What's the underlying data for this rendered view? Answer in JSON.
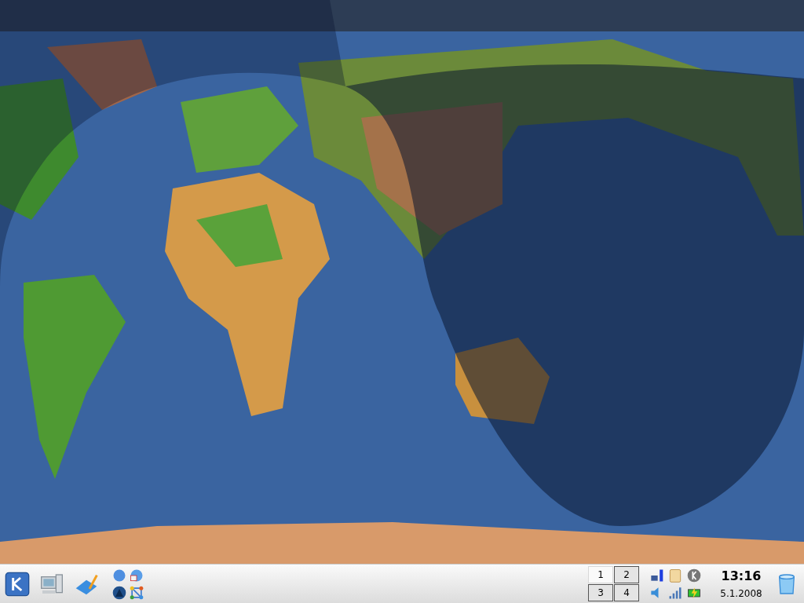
{
  "pager": {
    "desktops": [
      {
        "label": "1",
        "selected": true
      },
      {
        "label": "2",
        "selected": false
      },
      {
        "label": "3",
        "selected": false
      },
      {
        "label": "4",
        "selected": false
      }
    ]
  },
  "clock": {
    "time": "13:16",
    "date": "5.1.2008"
  }
}
